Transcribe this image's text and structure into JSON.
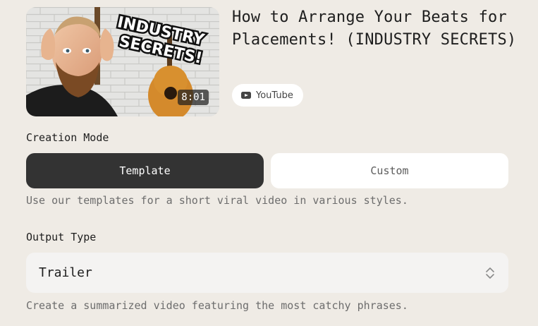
{
  "video": {
    "title": "How to Arrange Your Beats for Placements! (INDUSTRY SECRETS)",
    "duration": "8:01",
    "thumbnail_text_line1": "INDUSTRY",
    "thumbnail_text_line2": "SECRETS!",
    "source": "YouTube",
    "source_icon": "youtube-icon"
  },
  "creation_mode": {
    "label": "Creation Mode",
    "options": [
      {
        "label": "Template",
        "selected": true
      },
      {
        "label": "Custom",
        "selected": false
      }
    ],
    "help": "Use our templates for a short viral video in various styles."
  },
  "output_type": {
    "label": "Output Type",
    "value": "Trailer",
    "help": "Create a summarized video featuring the most catchy phrases.",
    "icon": "chevron-up-down-icon"
  },
  "colors": {
    "background": "#efebe5",
    "selected_button": "#333333",
    "unselected_button": "#ffffff",
    "select_background": "#f4f3f2",
    "helper_text": "#6d6d6d"
  }
}
